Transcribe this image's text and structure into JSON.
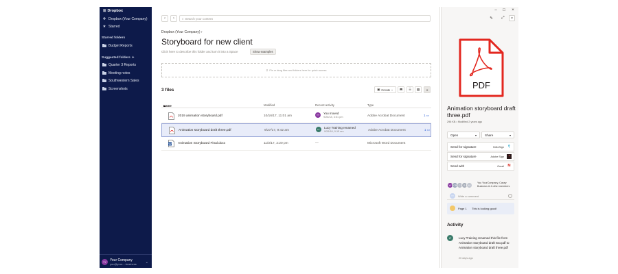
{
  "sidebar": {
    "app_name": "Dropbox",
    "top_items": [
      {
        "label": "Dropbox (Your Company)",
        "icon": "dropbox-icon"
      },
      {
        "label": "Starred",
        "icon": "star-icon"
      }
    ],
    "starred_heading": "Starred folders",
    "starred": [
      {
        "label": "Budget Reports",
        "icon": "folder-icon"
      }
    ],
    "suggested_heading": "Suggested folders",
    "suggested": [
      {
        "label": "Quarter 3 Reports",
        "icon": "folder-icon"
      },
      {
        "label": "Meeting notes",
        "icon": "folder-icon"
      },
      {
        "label": "Southwestern Sales",
        "icon": "folder-icon"
      },
      {
        "label": "Screenshots",
        "icon": "folder-icon"
      }
    ],
    "account": {
      "initials": "YY",
      "name": "Your Company",
      "email": "you@your-...business"
    }
  },
  "main": {
    "search_placeholder": "Search your content",
    "breadcrumb": "Dropbox (Your Company)",
    "title": "Storyboard for new client",
    "description": "Click here to describe this folder and turn it into a Space",
    "show_examples": "Show examples",
    "dropzone": "Pin or drag files and folders here for quick access",
    "files_count": "3 files",
    "create_label": "Create",
    "columns": {
      "name": "Name",
      "modified": "Modified",
      "activity": "Recent activity",
      "type": "Type"
    },
    "files": [
      {
        "name": "2019 animation storyboard.pdf",
        "modified": "10/16/17, 11:01 am",
        "activity_initials": "YY",
        "activity_color": "#8a3aa1",
        "activity_line1": "You moved",
        "activity_line2": "9/26/18, 3:51 pm",
        "type": "Adobe Acrobat Document",
        "comments": "1"
      },
      {
        "name": "Animation storyboard draft three.pdf",
        "modified": "9/27/17, 9:42 am",
        "activity_initials": "LT",
        "activity_color": "#3a7b6a",
        "activity_line1": "Lucy Training renamed",
        "activity_line2": "9/26/18, 9:15 am",
        "type": "Adobe Acrobat Document",
        "comments": "1"
      },
      {
        "name": "Animation Storyboard Final.docx",
        "modified": "11/3/17, 2:20 pm",
        "activity_dash": "—",
        "type": "Microsoft Word Document"
      }
    ]
  },
  "panel": {
    "file_name": "Animation storyboard draft three.pdf",
    "file_meta": "296 KB • Modified 2 years ago",
    "pdf_label": "PDF",
    "open_label": "Open",
    "share_label": "Share",
    "actions": [
      {
        "label": "Send for signature",
        "service": "HelloSign"
      },
      {
        "label": "Send for signature",
        "service": "Adobe Sign"
      },
      {
        "label": "Send with",
        "service": "Gmail"
      }
    ],
    "members": [
      {
        "initials": "YY",
        "color": "#8a3aa1"
      },
      {
        "initials": "CB",
        "color": "#9aa4b8"
      },
      {
        "initials": "C",
        "color": "#b5b9c4"
      },
      {
        "initials": "B",
        "color": "#a8aeb9"
      },
      {
        "initials": "+4",
        "color": "#c2c6cf"
      }
    ],
    "members_text": "You YourCompany, Casey Business & 4 other members",
    "comment_placeholder": "Write a comment",
    "comment_avatar": "YY",
    "note_page": "Page 1",
    "note_text": "This is looking good!",
    "activity_heading": "Activity",
    "activity_initials": "LT",
    "activity_text": "Lucy Training renamed this file from Animation storyboard draft two.pdf to Animation storyboard draft three.pdf",
    "activity_time": "20 days ago"
  }
}
